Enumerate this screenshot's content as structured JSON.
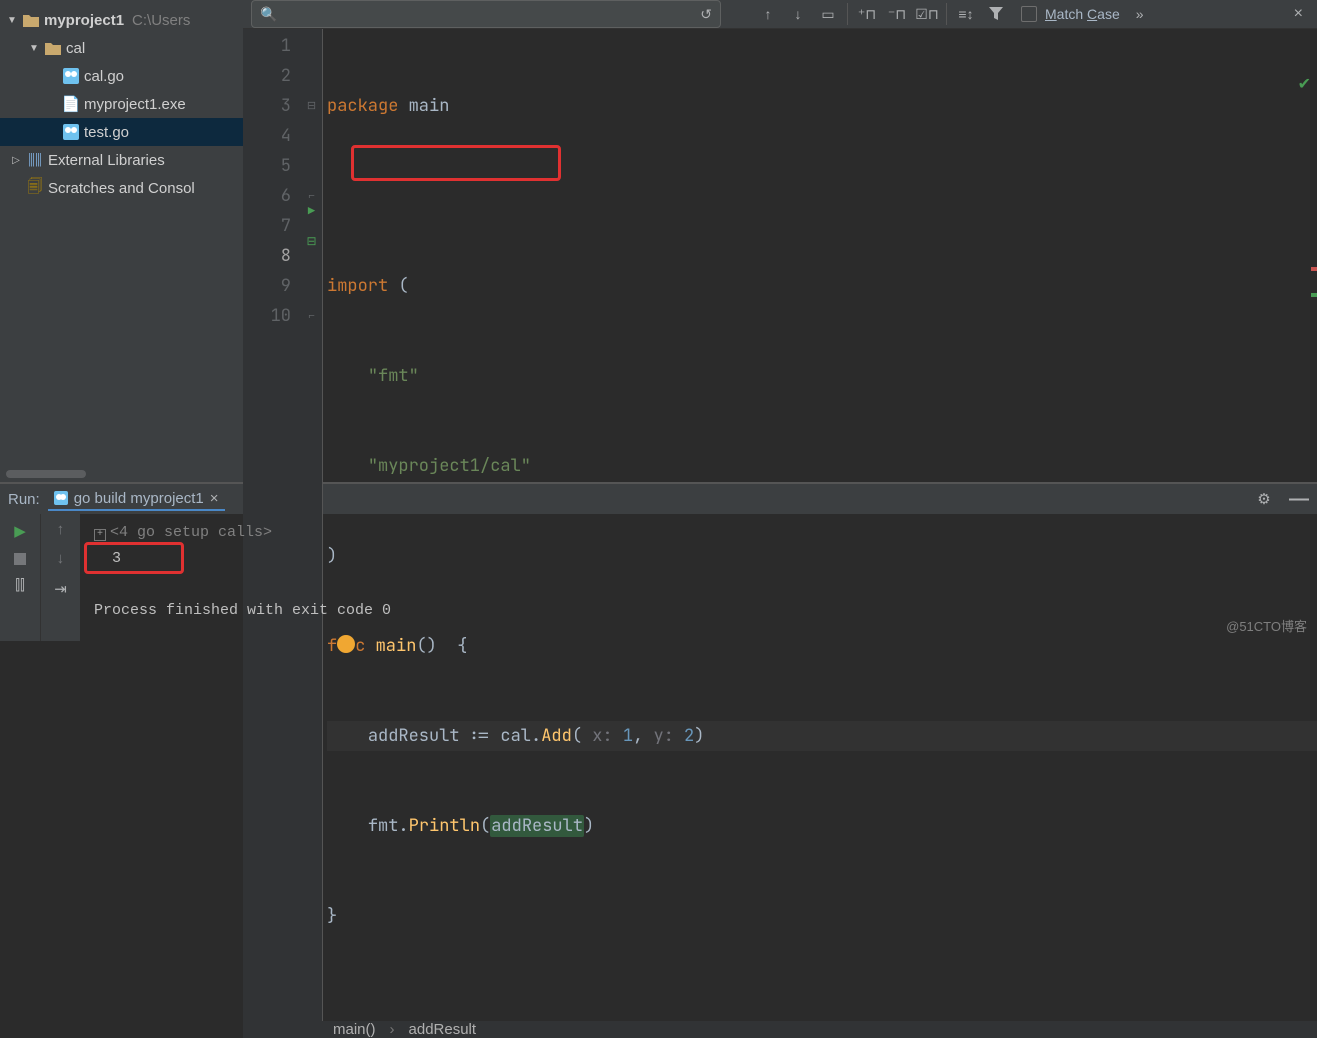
{
  "tree": {
    "project_name": "myproject1",
    "project_path": "C:\\Users",
    "cal_folder": "cal",
    "cal_file": "cal.go",
    "exe_file": "myproject1.exe",
    "test_file": "test.go",
    "external": "External Libraries",
    "scratches": "Scratches and Consol"
  },
  "findbar": {
    "placeholder": "",
    "match_case": "Match Case"
  },
  "editor": {
    "lines": [
      "1",
      "2",
      "3",
      "4",
      "5",
      "6",
      "7",
      "8",
      "9",
      "10"
    ],
    "line1_kw": "package",
    "line1_pkg": " main",
    "line3_kw": "import",
    "line3_paren": " (",
    "line4_str": "\"fmt\"",
    "line5_str": "\"myproject1/cal\"",
    "line6_paren": ")",
    "line7_kw": "func",
    "line7_fn": " main",
    "line7_rest": "()  {",
    "line8_a": "addResult := cal.",
    "line8_fn": "Add",
    "line8_b": "( ",
    "line8_px": "x:",
    "line8_n1": " 1",
    "line8_c": ", ",
    "line8_py": "y:",
    "line8_n2": " 2",
    "line8_d": ")",
    "line9_a": "fmt.",
    "line9_fn": "Println",
    "line9_b": "(",
    "line9_v": "addResult",
    "line9_c": ")",
    "line10": "}"
  },
  "breadcrumb": {
    "a": "main()",
    "b": "addResult"
  },
  "run": {
    "label": "Run:",
    "tab": "go build myproject1",
    "setup": "<4 go setup calls>",
    "output": "3",
    "exit": "Process finished with exit code 0"
  },
  "watermark": "@51CTO博客"
}
